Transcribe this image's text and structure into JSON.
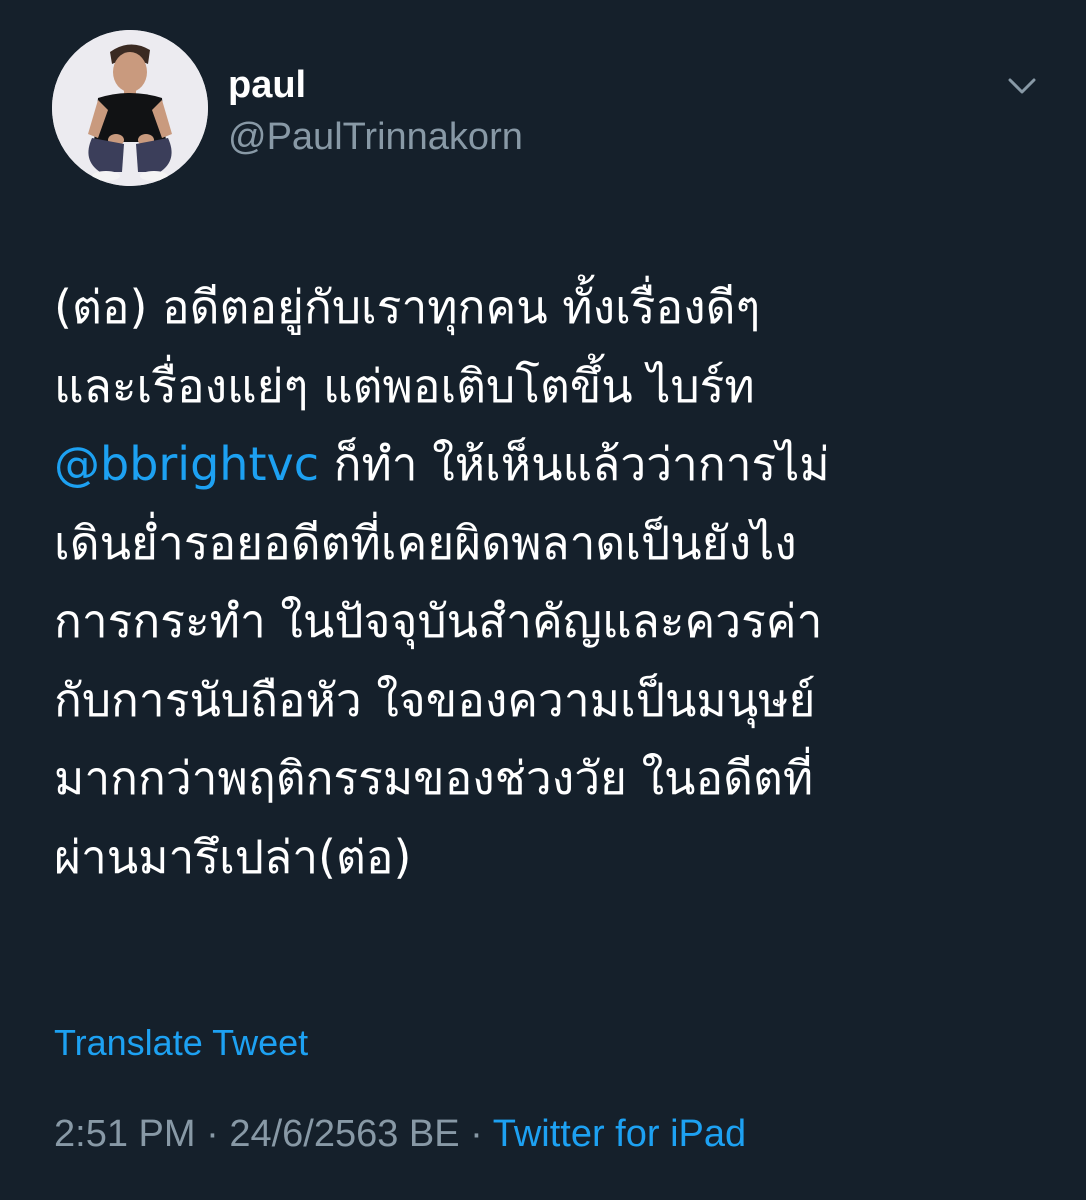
{
  "author": {
    "display_name": "paul",
    "handle": "@PaulTrinnakorn"
  },
  "tweet": {
    "lines": [
      {
        "text": "(ต่อ) อดีตอยู่กับเราทุกคน ทั้งเรื่องดีๆ"
      },
      {
        "text": "และเรื่องแย่ๆ แต่พอเติบโตขึ้น ไบร์ท"
      },
      {
        "mention": "@bbrightvc",
        "text": " ก็ทำ ให้เห็นแล้วว่าการไม่"
      },
      {
        "text": "เดินย่ำรอยอดีตที่เคยผิดพลาดเป็นยังไง"
      },
      {
        "text": "การกระทำ ในปัจจุบันสำคัญและควรค่า"
      },
      {
        "text": "กับการนับถือหัว ใจของความเป็นมนุษย์"
      },
      {
        "text": "มากกว่าพฤติกรรมของช่วงวัย ในอดีตที่"
      },
      {
        "text": "ผ่านมารึเปล่า(ต่อ)"
      }
    ]
  },
  "translate_label": "Translate Tweet",
  "meta": {
    "time": "2:51 PM",
    "separator": " · ",
    "date": "24/6/2563 BE",
    "separator2": " · ",
    "source": "Twitter for iPad"
  },
  "icons": {
    "menu": "chevron-down-icon"
  },
  "colors": {
    "background": "#15202b",
    "link": "#1da1f2",
    "secondary": "#8899a6"
  }
}
